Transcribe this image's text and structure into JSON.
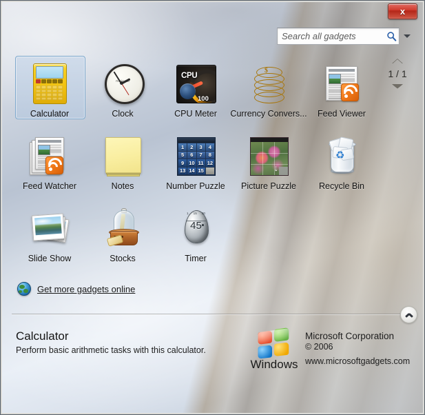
{
  "window": {
    "close_label": "x"
  },
  "search": {
    "placeholder": "Search all gadgets",
    "value": "",
    "icon": "search-icon",
    "dropdown_icon": "chevron-down-icon"
  },
  "pager": {
    "count": "1 / 1",
    "up_icon": "triangle-up-icon",
    "down_icon": "triangle-down-icon"
  },
  "gadgets": [
    {
      "name": "Calculator",
      "icon": "calculator-icon",
      "selected": true
    },
    {
      "name": "Clock",
      "icon": "clock-icon",
      "selected": false
    },
    {
      "name": "CPU Meter",
      "icon": "cpu-meter-icon",
      "selected": false
    },
    {
      "name": "Currency Convers...",
      "icon": "currency-coins-icon",
      "selected": false
    },
    {
      "name": "Feed Viewer",
      "icon": "feed-viewer-icon",
      "selected": false
    },
    {
      "name": "Feed Watcher",
      "icon": "feed-watcher-icon",
      "selected": false
    },
    {
      "name": "Notes",
      "icon": "notes-icon",
      "selected": false
    },
    {
      "name": "Number Puzzle",
      "icon": "number-puzzle-icon",
      "selected": false
    },
    {
      "name": "Picture Puzzle",
      "icon": "picture-puzzle-icon",
      "selected": false
    },
    {
      "name": "Recycle Bin",
      "icon": "recycle-bin-icon",
      "selected": false
    },
    {
      "name": "Slide Show",
      "icon": "slide-show-icon",
      "selected": false
    },
    {
      "name": "Stocks",
      "icon": "stocks-icon",
      "selected": false
    },
    {
      "name": "Timer",
      "icon": "timer-icon",
      "selected": false
    }
  ],
  "icon_values": {
    "cpu_label": "CPU",
    "cpu_value": "100",
    "clock_brand": "Redmond",
    "timer_value": "45",
    "timer_ticks": [
      "1",
      "15",
      "30"
    ],
    "number_puzzle_tiles": [
      "1",
      "2",
      "3",
      "4",
      "5",
      "6",
      "7",
      "8",
      "9",
      "10",
      "11",
      "12",
      "13",
      "14",
      "15",
      ""
    ],
    "currency_symbol": "$",
    "picture_puzzle_arrow": "↓",
    "recycle_symbol": "♻"
  },
  "get_more": {
    "label": "Get more gadgets online",
    "icon": "globe-icon"
  },
  "collapse": {
    "icon": "chevron-up-icon"
  },
  "details": {
    "name": "Calculator",
    "description": "Perform basic arithmetic tasks with this calculator.",
    "publisher": "Microsoft Corporation",
    "copyright": "© 2006",
    "url": "www.microsoftgadgets.com",
    "brand": "Windows",
    "brand_tm": "™"
  },
  "colors": {
    "close_button": "#cf3a2c",
    "selection_border": "#7ca7cc",
    "rss_orange": "#f07818",
    "link_text": "#1a1a1a"
  }
}
